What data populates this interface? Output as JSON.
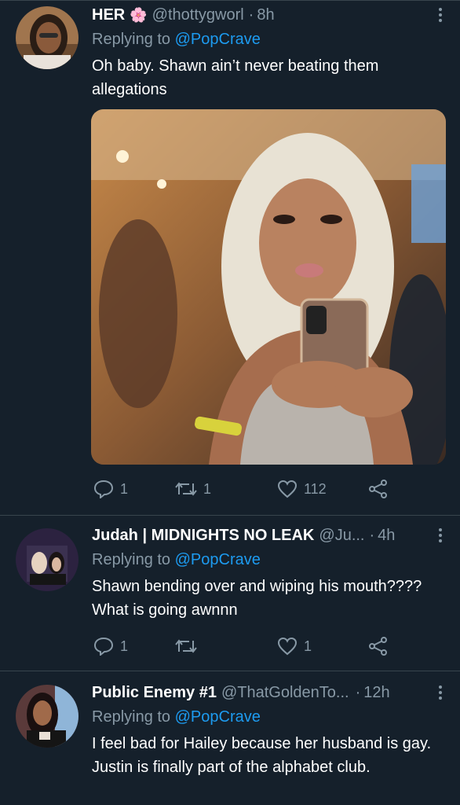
{
  "tweets": [
    {
      "name": "HER",
      "name_emoji": "🌸",
      "handle": "@thottygworl",
      "time": "8h",
      "replying_prefix": "Replying to",
      "replying_to": "@PopCrave",
      "text": "Oh baby. Shawn ain’t never beating them allegations",
      "replies": "1",
      "retweets": "1",
      "likes": "112"
    },
    {
      "name": "Judah | MIDNIGHTS NO LEAK",
      "handle": "@Ju...",
      "time": "4h",
      "replying_prefix": "Replying to",
      "replying_to": "@PopCrave",
      "text": "Shawn bending over and wiping his mouth???? What is going awnnn",
      "replies": "1",
      "retweets": "",
      "likes": "1"
    },
    {
      "name": "Public Enemy #1",
      "handle": "@ThatGoldenTo...",
      "time": "12h",
      "replying_prefix": "Replying to",
      "replying_to": "@PopCrave",
      "text": "I feel bad for Hailey because her husband is gay. Justin is finally part of the alphabet club.",
      "replies": "",
      "retweets": "",
      "likes": ""
    }
  ],
  "icons": {
    "reply": "reply-icon",
    "retweet": "retweet-icon",
    "like": "heart-icon",
    "share": "share-icon",
    "more": "more-vertical-icon"
  },
  "colors": {
    "background": "#15202b",
    "link": "#1d9bf0",
    "muted": "#8899a6",
    "divider": "#38444d"
  }
}
